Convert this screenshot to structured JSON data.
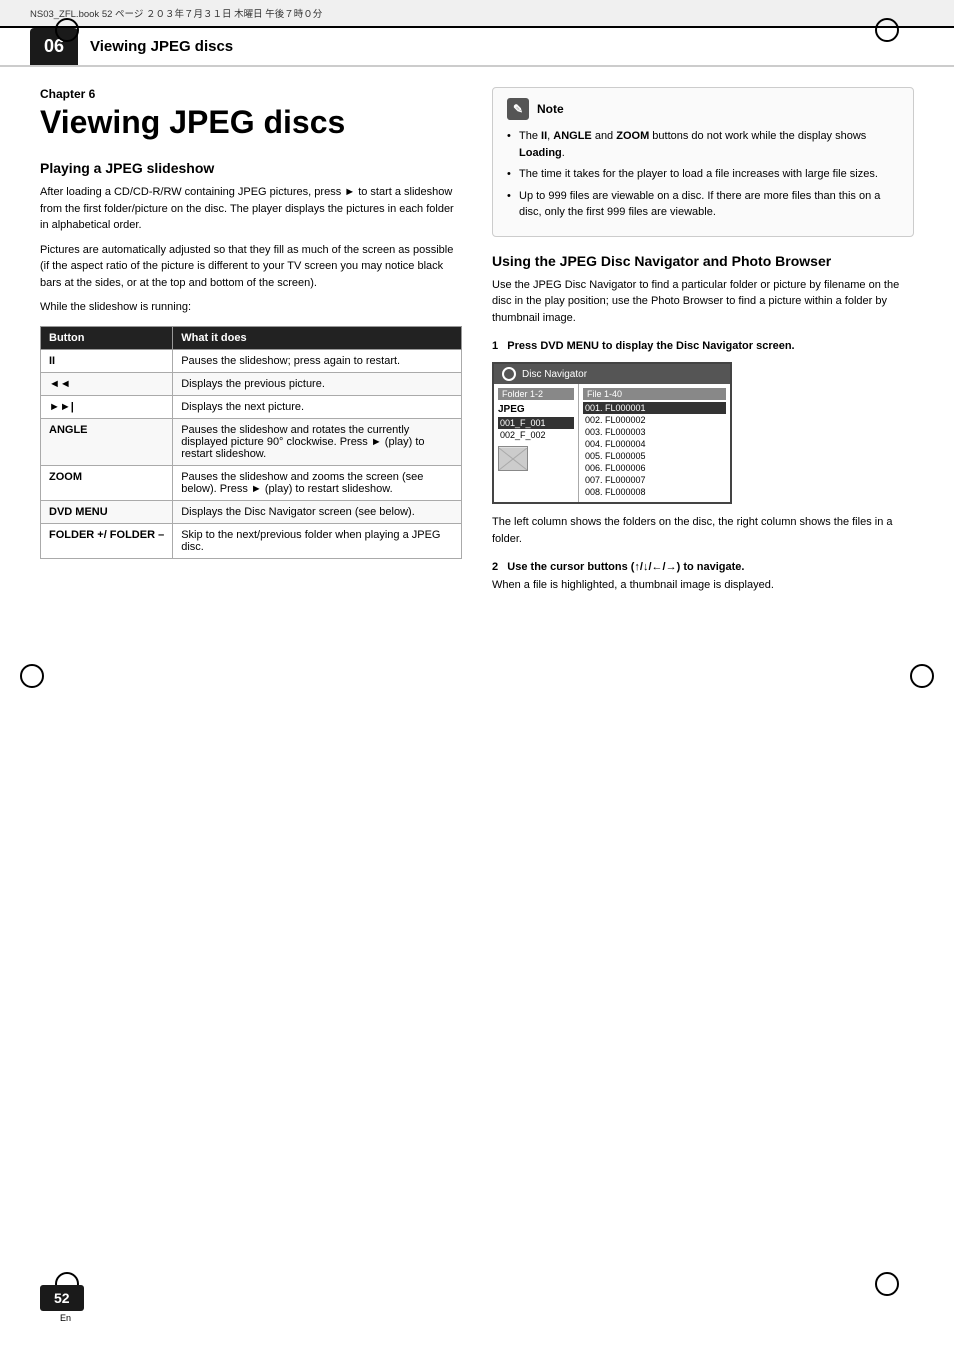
{
  "topbar": {
    "file_info": "NS03_ZFL.book  52 ページ  ２０３年７月３１日  木曜日  午後７時０分"
  },
  "chapter": {
    "number": "06",
    "title": "Viewing JPEG discs",
    "label": "Chapter 6"
  },
  "page_number": "52",
  "page_lang": "En",
  "section_left": {
    "heading": "Playing a JPEG slideshow",
    "para1": "After loading a CD/CD-R/RW containing JPEG pictures, press ► to start a slideshow from the first folder/picture on the disc. The player displays the pictures in each folder in alphabetical order.",
    "para2": "Pictures are automatically adjusted so that they fill as much of the screen as possible (if the aspect ratio of the picture is different to your TV screen you may notice black bars at the sides, or at the top and bottom of the screen).",
    "para3": "While the slideshow is running:",
    "table": {
      "col1": "Button",
      "col2": "What it does",
      "rows": [
        {
          "button": "II",
          "desc": "Pauses the slideshow; press again to restart."
        },
        {
          "button": "◄◄",
          "desc": "Displays the previous picture."
        },
        {
          "button": "►►|",
          "desc": "Displays the next picture."
        },
        {
          "button": "ANGLE",
          "desc": "Pauses the slideshow and rotates the currently displayed picture 90° clockwise. Press ► (play) to restart slideshow."
        },
        {
          "button": "ZOOM",
          "desc": "Pauses the slideshow and zooms the screen (see below). Press ► (play) to restart slideshow."
        },
        {
          "button": "DVD MENU",
          "desc": "Displays the Disc Navigator screen (see below)."
        },
        {
          "button": "FOLDER +/ FOLDER –",
          "desc": "Skip to the next/previous folder when playing a JPEG disc."
        }
      ]
    }
  },
  "section_right": {
    "note": {
      "label": "Note",
      "items": [
        "The II, ANGLE and ZOOM buttons do not work while the display shows Loading.",
        "The time it takes for the player to load a file increases with large file sizes.",
        "Up to 999 files are viewable on a disc. If there are more files than this on a disc, only the first 999 files are viewable."
      ]
    },
    "heading": "Using the JPEG Disc Navigator and Photo Browser",
    "para1": "Use the JPEG Disc Navigator to find a particular folder or picture by filename on the disc in the play position; use the Photo Browser to find a picture within a folder by thumbnail image.",
    "step1": {
      "label": "1",
      "text": "Press DVD MENU to display the Disc Navigator screen."
    },
    "disc_nav": {
      "title": "Disc Navigator",
      "folder_header": "Folder 1-2",
      "file_header": "File 1-40",
      "jpeg_label": "JPEG",
      "folders": [
        {
          "id": "001_F_001",
          "selected": true
        },
        {
          "id": "002_F_002",
          "selected": false
        }
      ],
      "files": [
        {
          "id": "001. FL000001",
          "selected": true
        },
        {
          "id": "002. FL000002",
          "selected": false
        },
        {
          "id": "003. FL000003",
          "selected": false
        },
        {
          "id": "004. FL000004",
          "selected": false
        },
        {
          "id": "005. FL000005",
          "selected": false
        },
        {
          "id": "006. FL000006",
          "selected": false
        },
        {
          "id": "007. FL000007",
          "selected": false
        },
        {
          "id": "008. FL000008",
          "selected": false
        }
      ]
    },
    "desc_after_nav": "The left column shows the folders on the disc, the right column shows the files in a folder.",
    "step2": {
      "label": "2",
      "text": "Use the cursor buttons (↑/↓/←/→) to navigate."
    },
    "para_step2": "When a file is highlighted, a thumbnail image is displayed."
  }
}
